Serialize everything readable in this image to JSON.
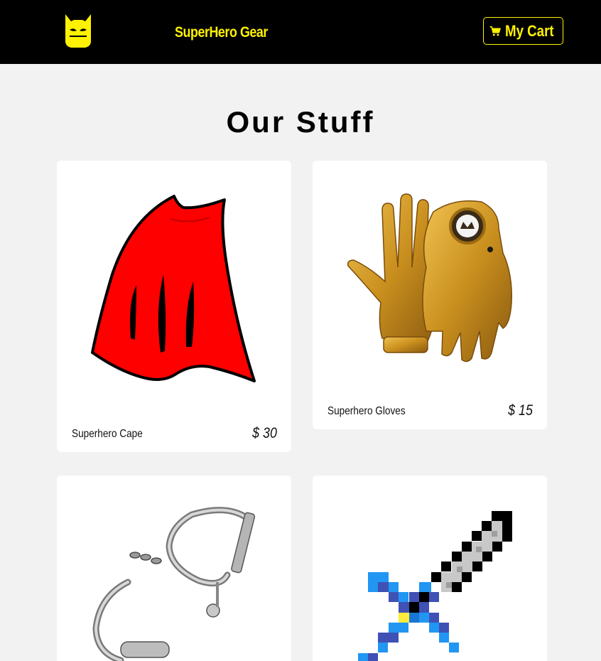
{
  "navbar": {
    "logo_icon": "batman-mask-icon",
    "brand": "SuperHero Gear",
    "cart": {
      "icon": "shopping-cart-icon",
      "label": "My Cart"
    },
    "accent_color": "#fff200",
    "background": "#000000"
  },
  "main": {
    "heading": "Our Stuff",
    "products": [
      {
        "name": "Superhero Cape",
        "price": "$ 30",
        "image": "red-cape-image"
      },
      {
        "name": "Superhero Gloves",
        "price": "$ 15",
        "image": "gold-gloves-image"
      },
      {
        "name": "",
        "price": "",
        "image": "handcuffs-image"
      },
      {
        "name": "",
        "price": "",
        "image": "pixel-sword-image"
      }
    ]
  }
}
